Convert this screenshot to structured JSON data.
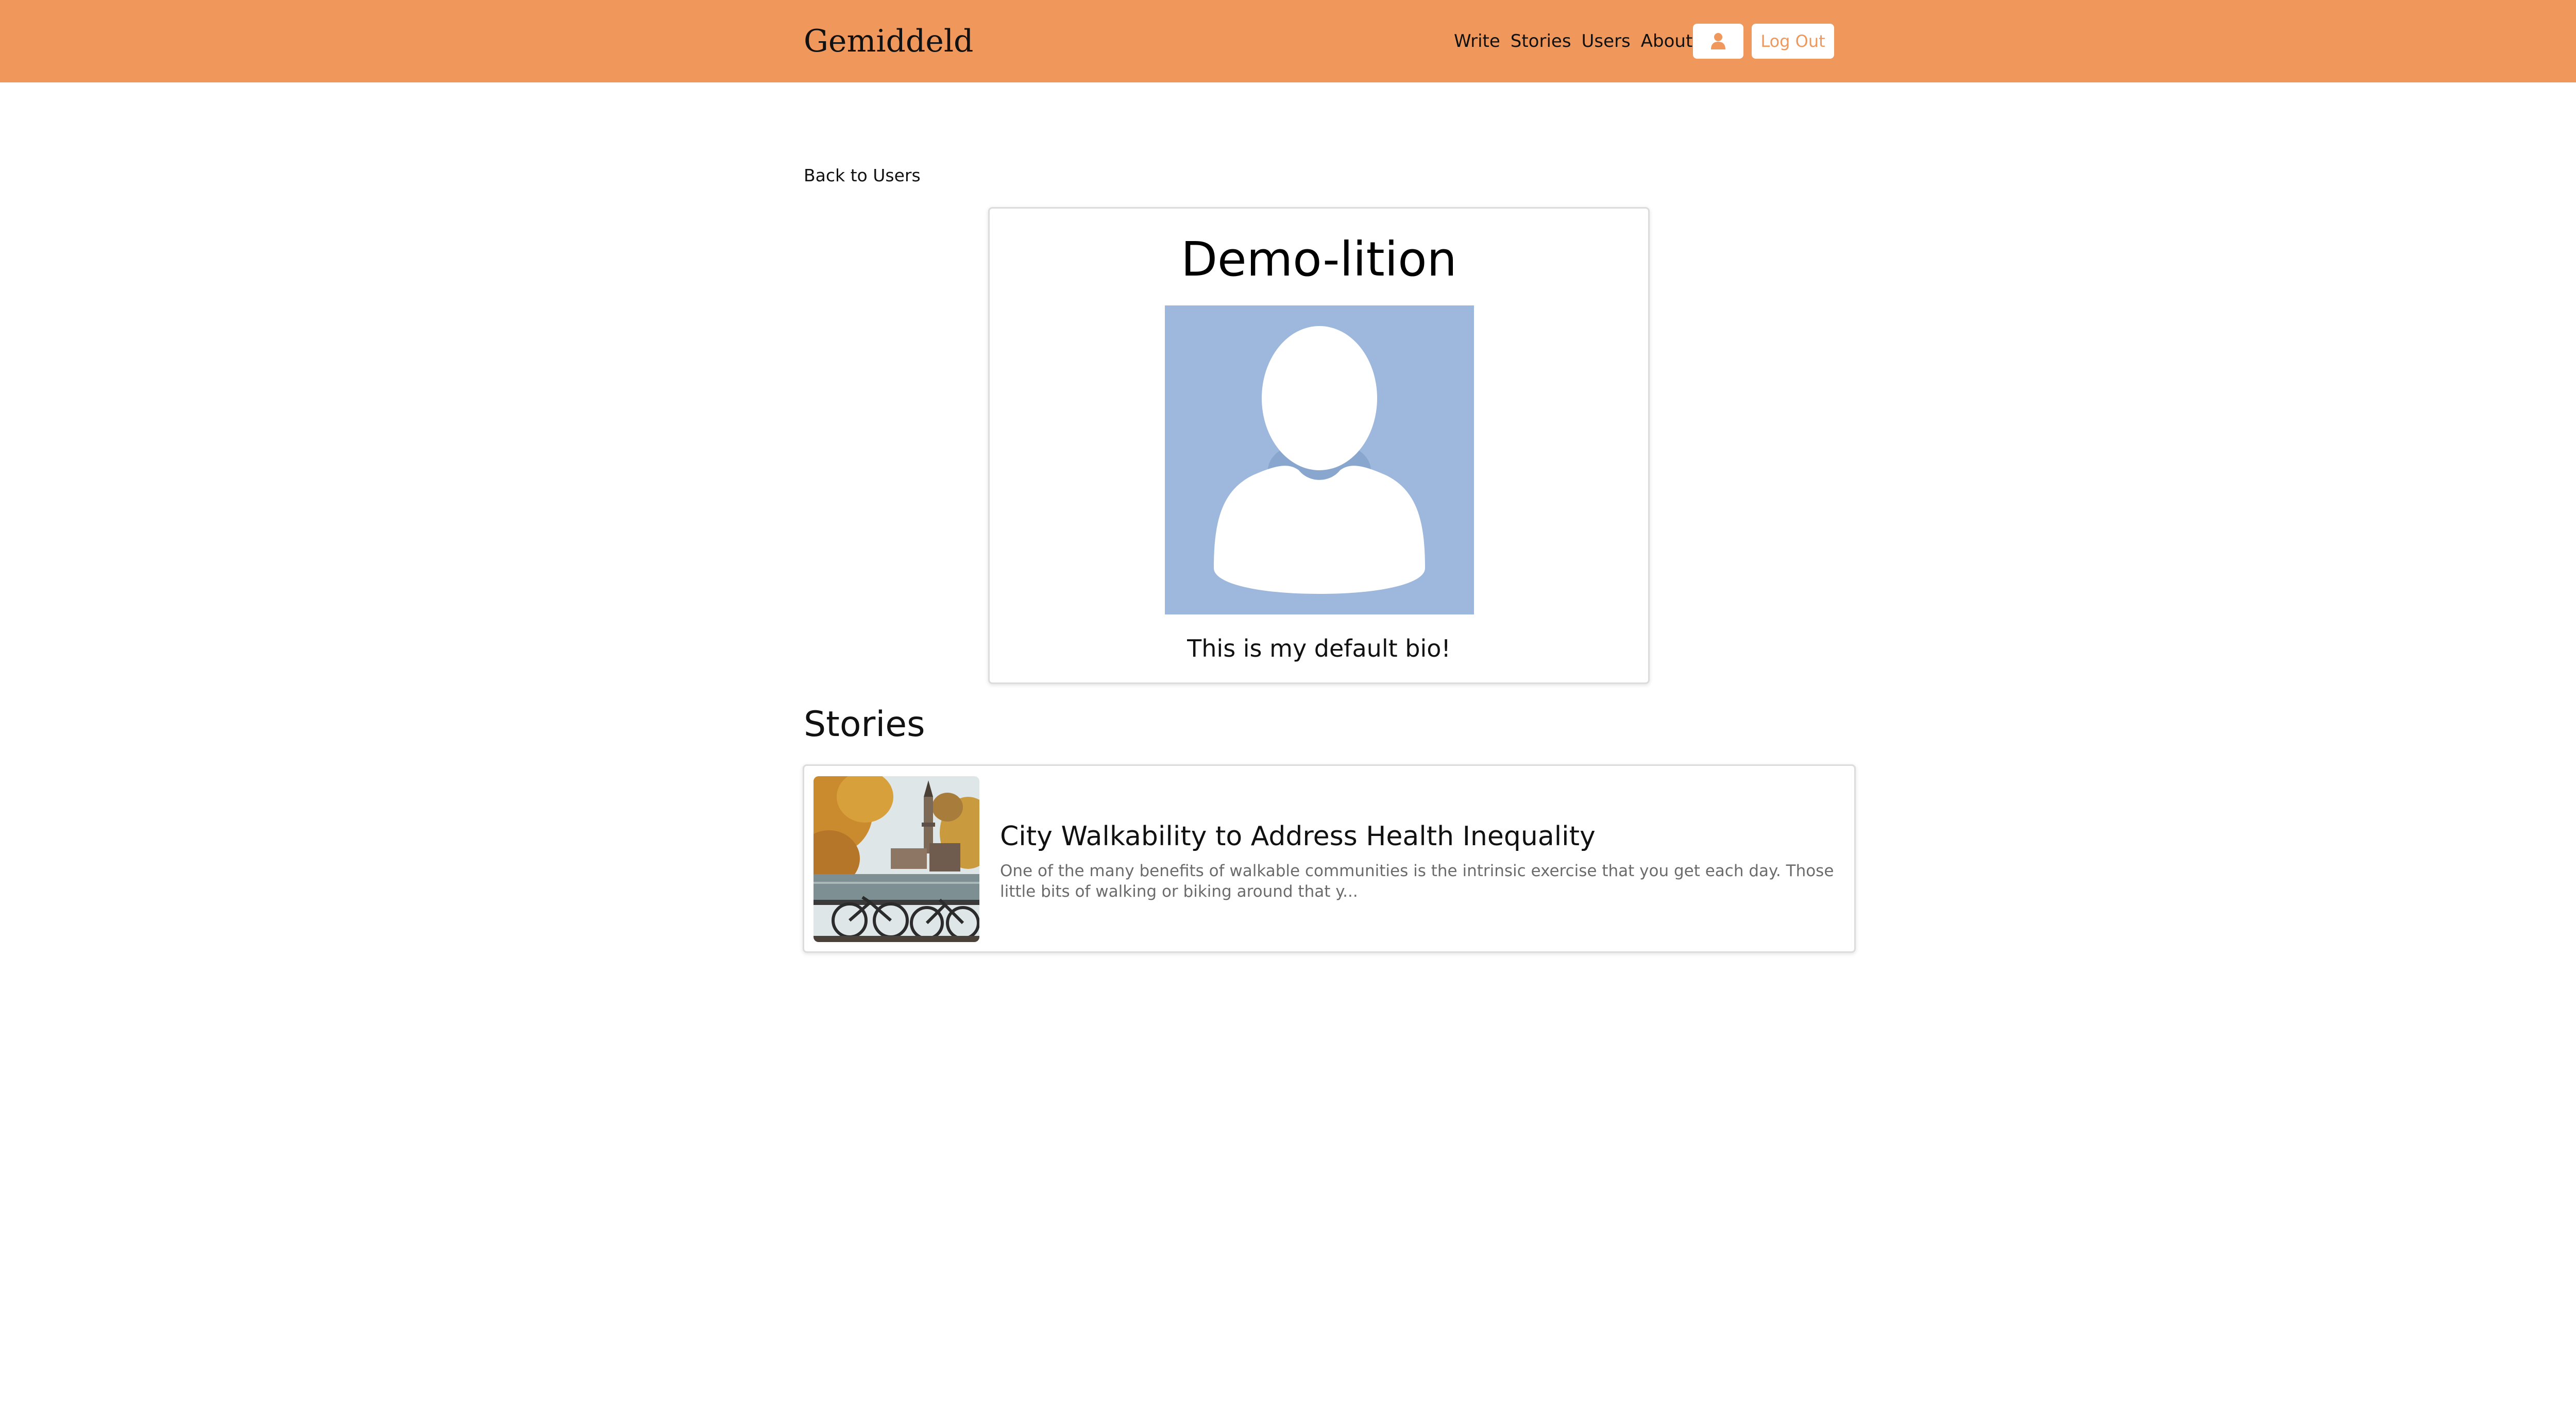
{
  "nav": {
    "brand": "Gemiddeld",
    "links": [
      "Write",
      "Stories",
      "Users",
      "About"
    ],
    "profile_icon": "user-icon",
    "logout_label": "Log Out"
  },
  "back_link": "Back to Users",
  "profile": {
    "name": "Demo-lition",
    "avatar_icon": "default-avatar-silhouette",
    "bio": "This is my default bio!"
  },
  "stories_heading": "Stories",
  "stories": [
    {
      "title": "City Walkability to Address Health Inequality",
      "excerpt": "One of the many benefits of walkable communities is the intrinsic exercise that you get each day. Those little bits of walking or biking around that y..."
    }
  ],
  "colors": {
    "accent": "#f0975b",
    "avatar_bg": "#9db8dc",
    "muted_text": "#6b6b6b"
  }
}
